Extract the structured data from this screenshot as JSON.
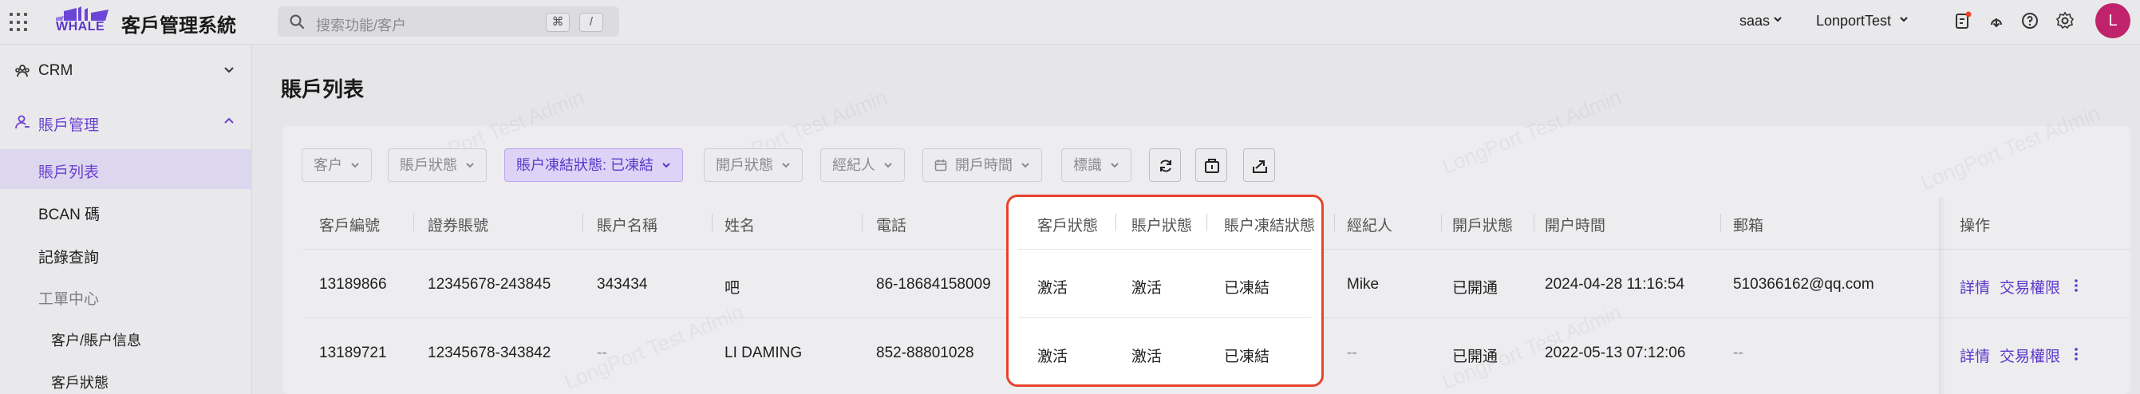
{
  "app": {
    "logo_text": "WHALE",
    "title": "客戶管理系統"
  },
  "search": {
    "placeholder": "搜索功能/客户",
    "shortcut_1": "⌘",
    "shortcut_2": "/"
  },
  "topbar": {
    "env": "saas",
    "org": "LonportTest",
    "avatar_letter": "L"
  },
  "sidebar": {
    "crm": "CRM",
    "account_mgmt": "賬戶管理",
    "account_list": "賬戶列表",
    "bcan": "BCAN 碼",
    "records": "記錄查詢",
    "ticket_center": "工單中心",
    "customer_info": "客户/賬户信息",
    "customer_status": "客戶狀態"
  },
  "page": {
    "title": "賬戶列表"
  },
  "filters": {
    "customer": "客户",
    "account_status": "賬戶狀態",
    "freeze_status": "賬户凍結狀態: 已凍結",
    "open_status": "開戶狀態",
    "broker": "經紀人",
    "open_time": "開戶時間",
    "tags": "標識"
  },
  "table": {
    "headers": {
      "customer_no": "客戶編號",
      "securities_account": "證券賬號",
      "account_name": "賬户名稱",
      "name": "姓名",
      "phone": "電話",
      "customer_status": "客戶狀態",
      "account_status": "賬户狀態",
      "freeze_status": "賬户凍結狀態",
      "broker": "經紀人",
      "open_status": "開戶狀態",
      "open_time": "開户時間",
      "email": "郵箱",
      "actions": "操作"
    },
    "rows": [
      {
        "customer_no": "13189866",
        "securities_account": "12345678-243845",
        "account_name": "343434",
        "name": "吧",
        "phone": "86-18684158009",
        "customer_status": "激活",
        "account_status": "激活",
        "freeze_status": "已凍結",
        "broker": "Mike",
        "open_status": "已開通",
        "open_time": "2024-04-28 11:16:54",
        "email": "510366162@qq.com",
        "detail": "詳情",
        "trade_perm": "交易權限"
      },
      {
        "customer_no": "13189721",
        "securities_account": "12345678-343842",
        "account_name": "--",
        "name": "LI DAMING",
        "phone": "852-88801028",
        "customer_status": "激活",
        "account_status": "激活",
        "freeze_status": "已凍結",
        "broker": "--",
        "open_status": "已開通",
        "open_time": "2022-05-13 07:12:06",
        "email": "--",
        "detail": "詳情",
        "trade_perm": "交易權限"
      }
    ]
  },
  "watermark": "LongPort Test Admin",
  "colors": {
    "accent": "#5b37c9",
    "highlight_border": "#e8432c",
    "avatar": "#c0226b"
  }
}
